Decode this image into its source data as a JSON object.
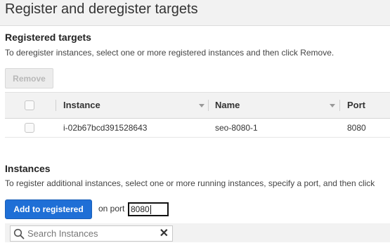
{
  "header": {
    "title": "Register and deregister targets"
  },
  "registered": {
    "title": "Registered targets",
    "description": "To deregister instances, select one or more registered instances and then click Remove.",
    "remove_label": "Remove",
    "columns": {
      "instance": "Instance",
      "name": "Name",
      "port": "Port"
    },
    "rows": [
      {
        "instance": "i-02b67bcd391528643",
        "name": "seo-8080-1",
        "port": "8080"
      }
    ]
  },
  "instances": {
    "title": "Instances",
    "description": "To register additional instances, select one or more running instances, specify a port, and then click",
    "add_label": "Add to registered",
    "port_label": "on port",
    "port_value": "8080",
    "search_placeholder": "Search Instances"
  },
  "colors": {
    "primary": "#1f6fd6",
    "header_bg": "#f2f2f2"
  },
  "icons": {
    "search": "search-icon",
    "clear": "close-icon",
    "sort": "caret-down-icon"
  }
}
